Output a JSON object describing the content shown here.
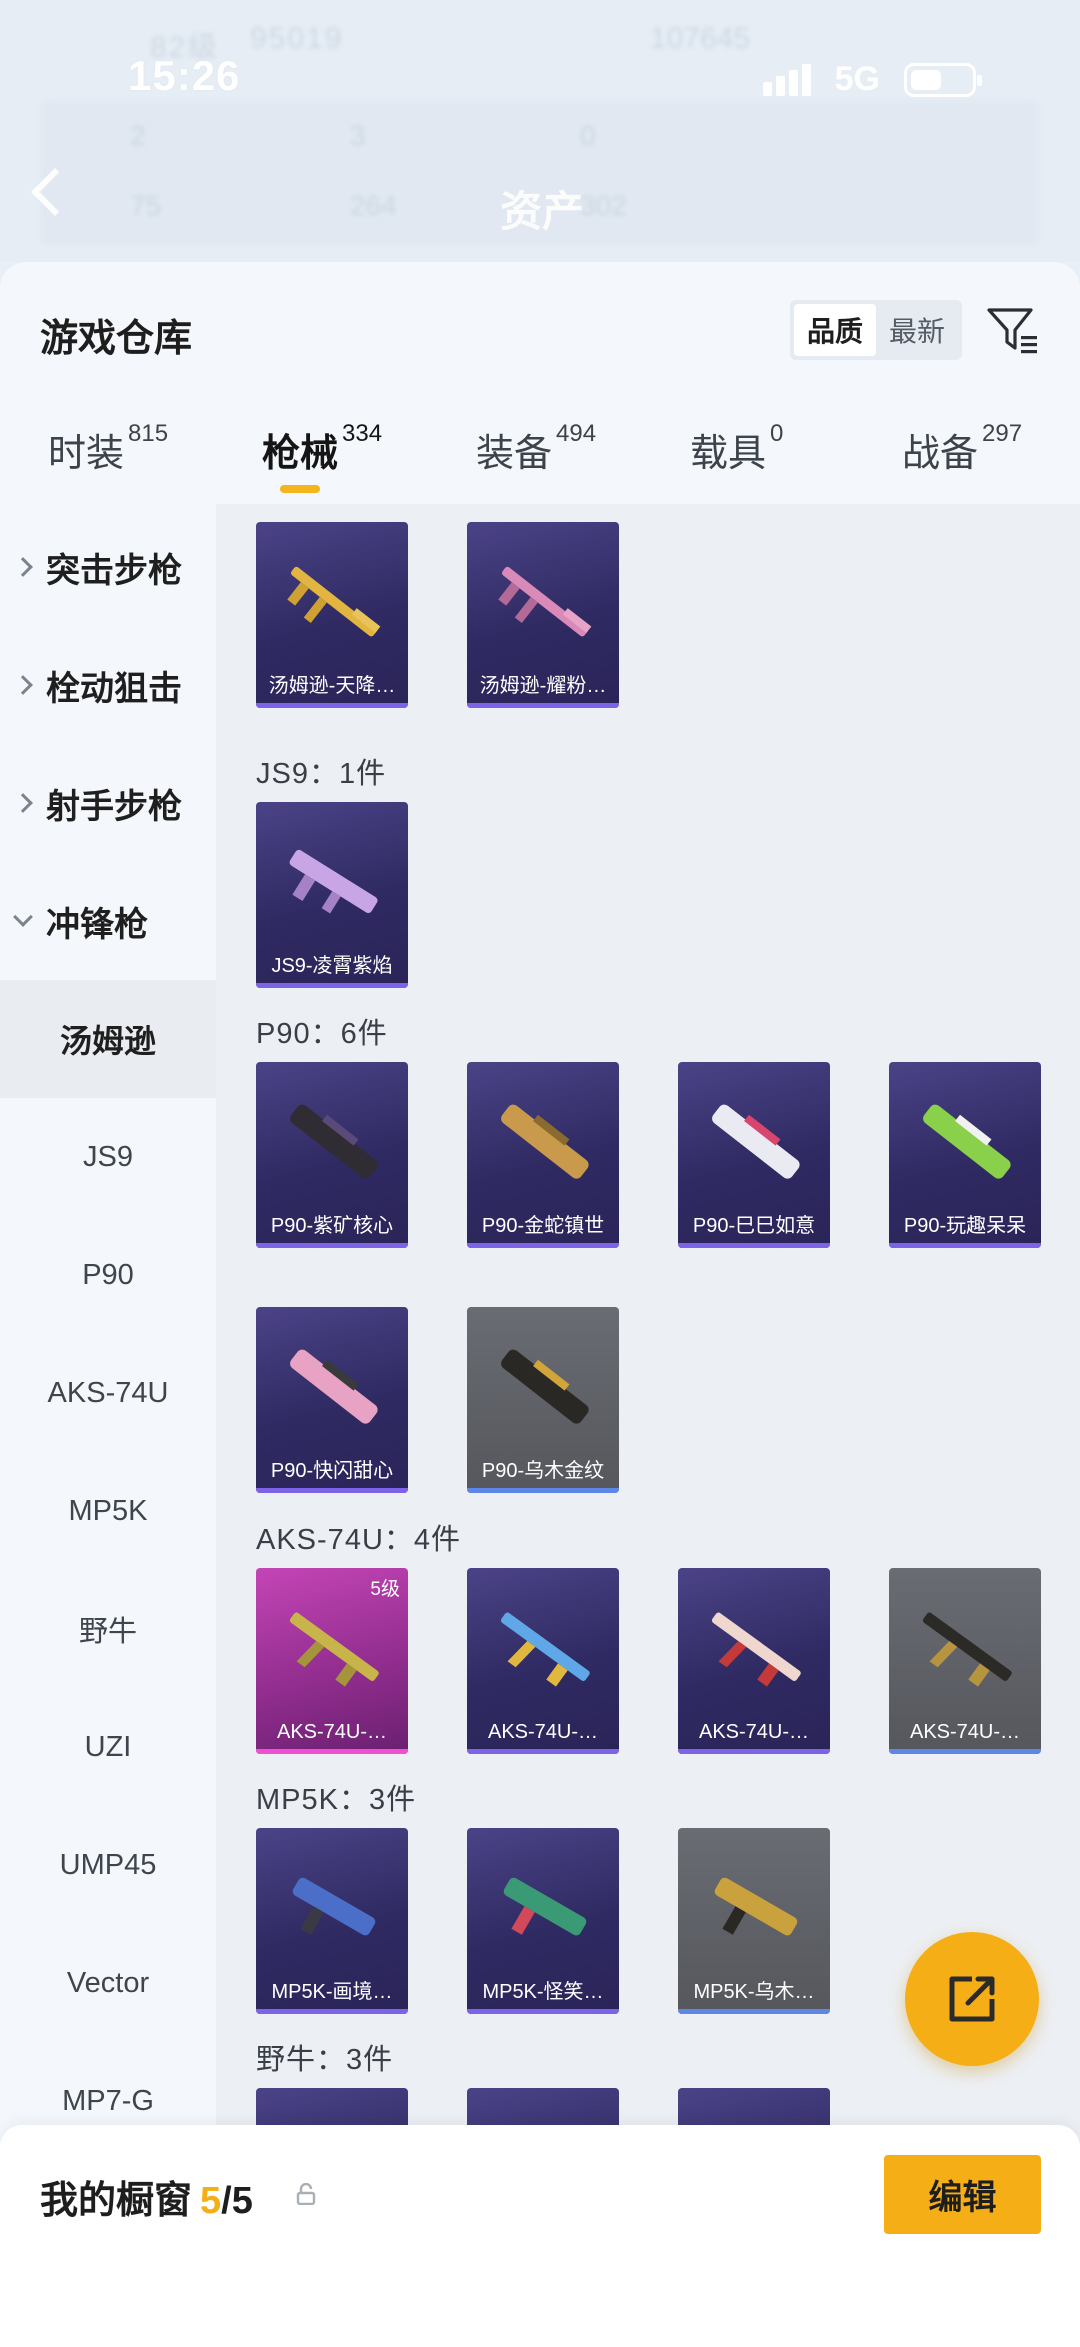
{
  "status_bar": {
    "time": "15:26",
    "network": "5G"
  },
  "background_header": {
    "level": "82级",
    "coins": "95019",
    "score": "107645",
    "stats": [
      "2",
      "3",
      "0",
      "75",
      "264",
      "302"
    ],
    "title": "资产"
  },
  "sheet": {
    "title": "游戏仓库",
    "sort_options": [
      "品质",
      "最新"
    ],
    "active_sort": "品质"
  },
  "tabs": [
    {
      "label": "时装",
      "count": "815"
    },
    {
      "label": "枪械",
      "count": "334"
    },
    {
      "label": "装备",
      "count": "494"
    },
    {
      "label": "载具",
      "count": "0"
    },
    {
      "label": "战备",
      "count": "297"
    }
  ],
  "categories": {
    "parents": [
      "突击步枪",
      "栓动狙击",
      "射手步枪",
      "冲锋枪"
    ],
    "subs": [
      "汤姆逊",
      "JS9",
      "P90",
      "AKS-74U",
      "MP5K",
      "野牛",
      "UZI",
      "UMP45",
      "Vector",
      "MP7-G"
    ]
  },
  "sections": {
    "js9": "JS9：1件",
    "p90": "P90：6件",
    "aks": "AKS-74U：4件",
    "mp5k": "MP5K：3件",
    "bison": "野牛：3件"
  },
  "items": {
    "thompson": [
      "汤姆逊-天降…",
      "汤姆逊-耀粉…"
    ],
    "js9": [
      "JS9-凌霄紫焰"
    ],
    "p90": [
      "P90-紫矿核心",
      "P90-金蛇镇世",
      "P90-巳巳如意",
      "P90-玩趣呆呆",
      "P90-快闪甜心",
      "P90-乌木金纹"
    ],
    "aks": [
      "AKS-74U-…",
      "AKS-74U-…",
      "AKS-74U-…",
      "AKS-74U-…"
    ],
    "aks_level": "5级",
    "mp5k": [
      "MP5K-画境…",
      "MP5K-怪笑…",
      "MP5K-乌木…"
    ]
  },
  "showcase": {
    "label": "我的橱窗",
    "current": "5",
    "total": "/5"
  },
  "edit_label": "编辑",
  "colors": {
    "accent": "#f6ae16",
    "purple_rarity": "#7d63e8",
    "pink_rarity": "#f04fd2",
    "blue_rarity": "#5d87e6"
  }
}
